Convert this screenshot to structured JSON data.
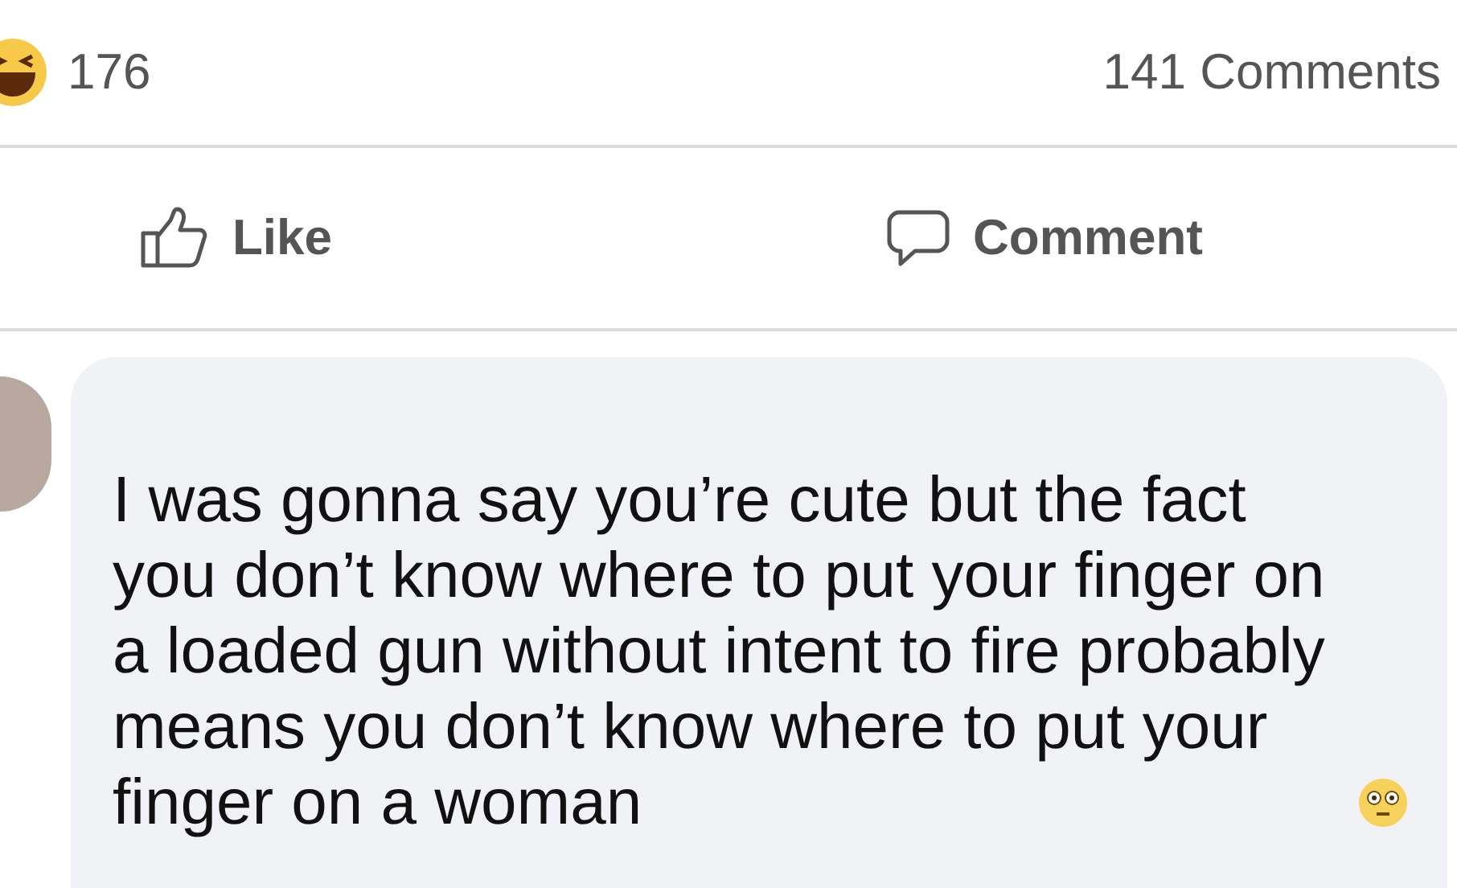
{
  "reactions": {
    "count": "176"
  },
  "comments_count": "141 Comments",
  "actions": [
    {
      "kind": "like",
      "label": "Like"
    },
    {
      "kind": "comment",
      "label": "Comment"
    }
  ],
  "comment": {
    "text": "I was gonna say you’re cute but the fact you don’t know where to put your finger on a loaded gun without intent to fire probably means you don’t know where to put your finger on a woman"
  }
}
